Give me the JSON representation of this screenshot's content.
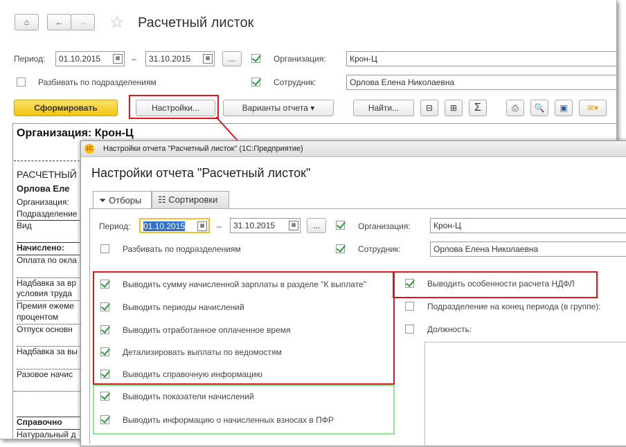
{
  "header": {
    "title": "Расчетный листок"
  },
  "filters": {
    "period_label": "Период:",
    "date_from": "01.10.2015",
    "dash": "–",
    "date_to": "31.10.2015",
    "more": "...",
    "org_label": "Организация:",
    "org_value": "Крон-Ц",
    "split_label": "Разбивать по подразделениям",
    "emp_label": "Сотрудник:",
    "emp_value": "Орлова Елена Николаевна"
  },
  "toolbar": {
    "generate": "Сформировать",
    "settings": "Настройки...",
    "variants": "Варианты отчета",
    "find": "Найти..."
  },
  "report": {
    "org_title": "Организация: Крон-Ц",
    "lines": [
      "РАСЧЕТНЫЙ",
      "Орлова Еле",
      "Организация:",
      "Подразделение",
      "Вид",
      "Начислено:",
      "Оплата по окла",
      "Надбавка за вр",
      "условия труда",
      "Премия ежеме",
      "процентом",
      "Отпуск основн",
      "Надбавка за вы",
      "Разовое начис",
      "Справочно",
      "Натуральный д"
    ]
  },
  "dialog": {
    "window_title": "Настройки отчета \"Расчетный листок\" (1С:Предприятие)",
    "title": "Настройки отчета \"Расчетный листок\"",
    "tabs": [
      {
        "label": "Отборы",
        "icon": "filter-icon"
      },
      {
        "label": "Сортировки",
        "icon": "sort-icon"
      }
    ],
    "left_options": [
      {
        "label": "Выводить сумму начисленной зарплаты в разделе \"К выплате\"",
        "checked": true
      },
      {
        "label": "Выводить периоды начислений",
        "checked": true
      },
      {
        "label": "Выводить отработанное оплаченное время",
        "checked": true
      },
      {
        "label": "Детализировать выплаты по ведомостям",
        "checked": true
      },
      {
        "label": "Выводить справочную информацию",
        "checked": true
      },
      {
        "label": "Выводить показатели начислений",
        "checked": true
      },
      {
        "label": "Выводить информацию о начисленных взносах в ПФР",
        "checked": true
      }
    ],
    "right_options": [
      {
        "label": "Выводить особенности расчета НДФЛ",
        "checked": true
      },
      {
        "label": "Подразделение на конец периода (в группе):",
        "checked": false
      },
      {
        "label": "Должность:",
        "checked": false
      }
    ]
  },
  "colors": {
    "highlight_red": "#e8141b",
    "highlight_green": "#8ee88e",
    "generate_button": "#f5d020"
  }
}
